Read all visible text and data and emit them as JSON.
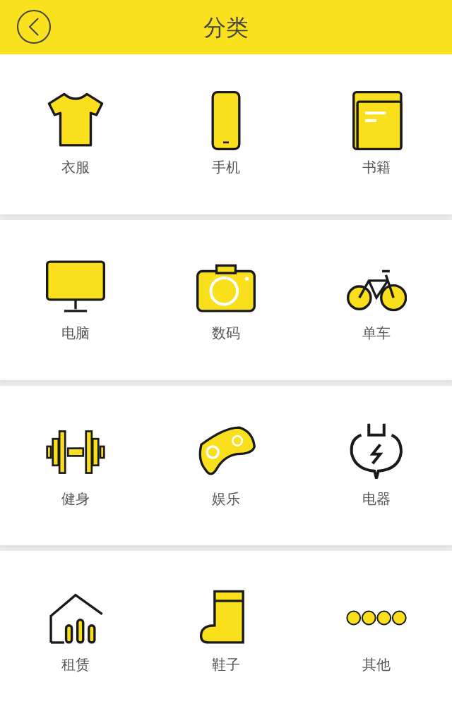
{
  "header": {
    "title": "分类"
  },
  "rows": [
    [
      {
        "kind": "shirt",
        "label": "衣服"
      },
      {
        "kind": "phone",
        "label": "手机"
      },
      {
        "kind": "book",
        "label": "书籍"
      }
    ],
    [
      {
        "kind": "monitor",
        "label": "电脑"
      },
      {
        "kind": "camera",
        "label": "数码"
      },
      {
        "kind": "bicycle",
        "label": "单车"
      }
    ],
    [
      {
        "kind": "dumbbell",
        "label": "健身"
      },
      {
        "kind": "gamepad",
        "label": "娱乐"
      },
      {
        "kind": "plug",
        "label": "电器"
      }
    ],
    [
      {
        "kind": "house",
        "label": "租赁"
      },
      {
        "kind": "boot",
        "label": "鞋子"
      },
      {
        "kind": "dots",
        "label": "其他"
      }
    ]
  ]
}
